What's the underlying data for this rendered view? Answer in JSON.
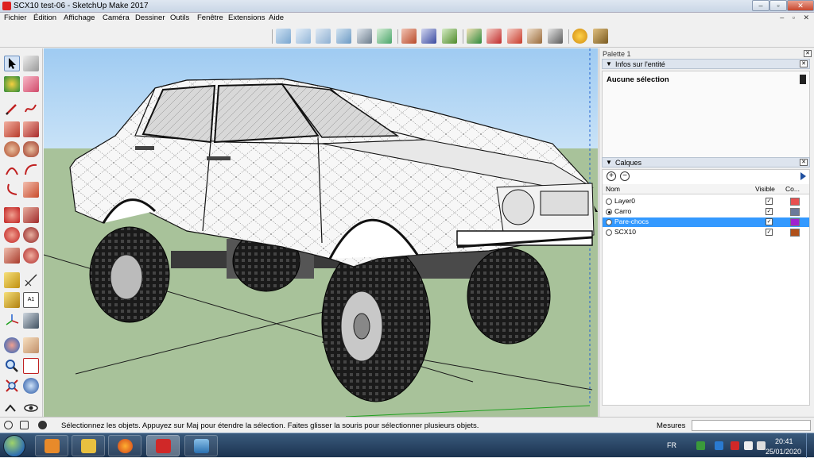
{
  "window": {
    "title": "SCX10 test-06 - SketchUp Make 2017",
    "minimize_glyph": "–",
    "maximize_glyph": "▫",
    "close_glyph": "✕"
  },
  "menu": {
    "items": [
      "Fichier",
      "Édition",
      "Affichage",
      "Caméra",
      "Dessiner",
      "Outils",
      "Fenêtre",
      "Extensions",
      "Aide"
    ],
    "mdi_controls": "– ▫ ✕"
  },
  "palette": {
    "title": "Palette 1",
    "entity_panel": {
      "title": "Infos sur l'entité",
      "selection": "Aucune sélection"
    },
    "layers_panel": {
      "title": "Calques",
      "add_glyph": "+",
      "remove_glyph": "−",
      "columns": {
        "name": "Nom",
        "visible": "Visible",
        "color": "Co..."
      },
      "layers": [
        {
          "name": "Layer0",
          "active": false,
          "visible": true,
          "color": "#e85050",
          "selected": false
        },
        {
          "name": "Carro",
          "active": true,
          "visible": true,
          "color": "#6b7a9a",
          "selected": false
        },
        {
          "name": "Pare-chocs",
          "active": false,
          "visible": true,
          "color": "#a020d0",
          "selected": true
        },
        {
          "name": "SCX10",
          "active": false,
          "visible": true,
          "color": "#b0501a",
          "selected": false
        }
      ]
    }
  },
  "status": {
    "message": "Sélectionnez les objets. Appuyez sur Maj pour étendre la sélection. Faites glisser la souris pour sélectionner plusieurs objets.",
    "measures_label": "Mesures"
  },
  "taskbar": {
    "language": "FR",
    "time": "20:41",
    "date": "25/01/2020"
  },
  "colors": {
    "sky": "#a9d2f4",
    "ground": "#a8c29a",
    "selection": "#3399ff",
    "axis_red": "#d02020",
    "axis_green": "#20a020"
  },
  "icons": {
    "select": "arrow-select-icon",
    "eraser": "eraser-icon",
    "paint": "paint-bucket-icon",
    "pencil": "pencil-icon",
    "orbit": "orbit-icon",
    "zoom": "zoom-icon",
    "camera_views": "iso-view-icon",
    "geolocation": "geolocation-icon",
    "extensions": "extension-warehouse-icon"
  }
}
